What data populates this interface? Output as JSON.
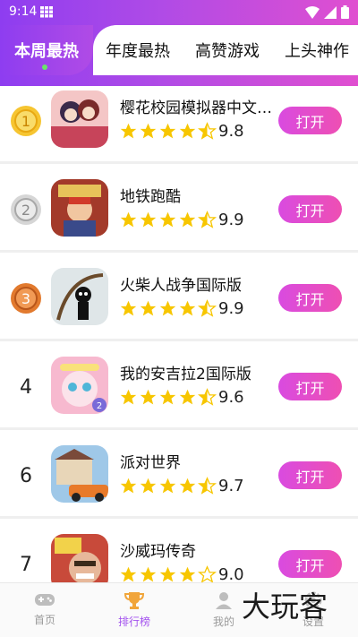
{
  "status_bar": {
    "time": "9:14"
  },
  "tabs": [
    {
      "label": "本周最热",
      "active": true
    },
    {
      "label": "年度最热"
    },
    {
      "label": "高赞游戏"
    },
    {
      "label": "上头神作"
    }
  ],
  "apps": [
    {
      "rank": "1",
      "rank_style": "gold",
      "name": "樱花校园模拟器中文…",
      "rating": 4.5,
      "score": "9.8",
      "button": "打开",
      "icon": "sakura-school-icon"
    },
    {
      "rank": "2",
      "rank_style": "silver",
      "name": "地铁跑酷",
      "rating": 4.5,
      "score": "9.9",
      "button": "打开",
      "icon": "subway-surfers-icon"
    },
    {
      "rank": "3",
      "rank_style": "bronze",
      "name": "火柴人战争国际版",
      "rating": 4.5,
      "score": "9.9",
      "button": "打开",
      "icon": "stick-war-icon"
    },
    {
      "rank": "4",
      "rank_style": "plain",
      "name": "我的安吉拉2国际版",
      "rating": 4.5,
      "score": "9.6",
      "button": "打开",
      "icon": "angela-icon"
    },
    {
      "rank": "6",
      "rank_style": "plain",
      "name": "派对世界",
      "rating": 4.5,
      "score": "9.7",
      "button": "打开",
      "icon": "party-world-icon"
    },
    {
      "rank": "7",
      "rank_style": "plain",
      "name": "沙威玛传奇",
      "rating": 4.0,
      "score": "9.0",
      "button": "打开",
      "icon": "shawarma-icon"
    }
  ],
  "bottom_nav": [
    {
      "label": "首页",
      "icon": "gamepad-icon"
    },
    {
      "label": "排行榜",
      "icon": "trophy-icon",
      "active": true
    },
    {
      "label": "我的",
      "icon": "user-icon"
    },
    {
      "label": "设置",
      "icon": "settings-icon"
    }
  ],
  "watermark": "大玩客",
  "colors": {
    "accent": "#a453ef",
    "button": "#e64dc6",
    "star": "#f7c600"
  }
}
